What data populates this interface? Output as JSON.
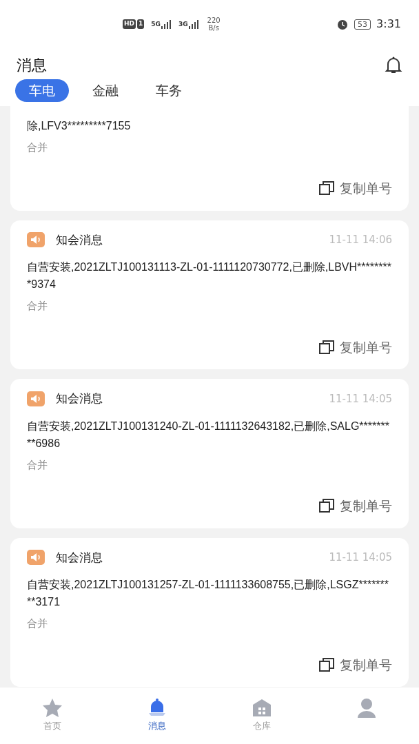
{
  "status_bar": {
    "indicators": [
      "HD",
      "1",
      "5G",
      "3G"
    ],
    "speed": "220",
    "speed_unit": "B/s",
    "battery": "53",
    "time": "3:31"
  },
  "header": {
    "title": "消息"
  },
  "tabs": [
    {
      "label": "车电",
      "selected": true
    },
    {
      "label": "金融",
      "selected": false
    },
    {
      "label": "车务",
      "selected": false
    }
  ],
  "messages": [
    {
      "kind": "partial",
      "body": "除,LFV3*********7155",
      "tag": "合并",
      "action": "复制单号"
    },
    {
      "title": "知会消息",
      "time": "11-11 14:06",
      "body": "自营安装,2021ZLTJ100131113-ZL-01-1111120730772,已删除,LBVH*********9374",
      "tag": "合并",
      "action": "复制单号"
    },
    {
      "title": "知会消息",
      "time": "11-11 14:05",
      "body": "自营安装,2021ZLTJ100131240-ZL-01-1111132643182,已删除,SALG*********6986",
      "tag": "合并",
      "action": "复制单号"
    },
    {
      "title": "知会消息",
      "time": "11-11 14:05",
      "body": "自营安装,2021ZLTJ100131257-ZL-01-1111133608755,已删除,LSGZ*********3171",
      "tag": "合并",
      "action": "复制单号"
    }
  ],
  "bottom_nav": [
    {
      "kind": "home",
      "label": "首页",
      "selected": false
    },
    {
      "kind": "messages",
      "label": "消息",
      "selected": true
    },
    {
      "kind": "warehouse",
      "label": "仓库",
      "selected": false
    },
    {
      "kind": "profile",
      "selected": false
    }
  ]
}
